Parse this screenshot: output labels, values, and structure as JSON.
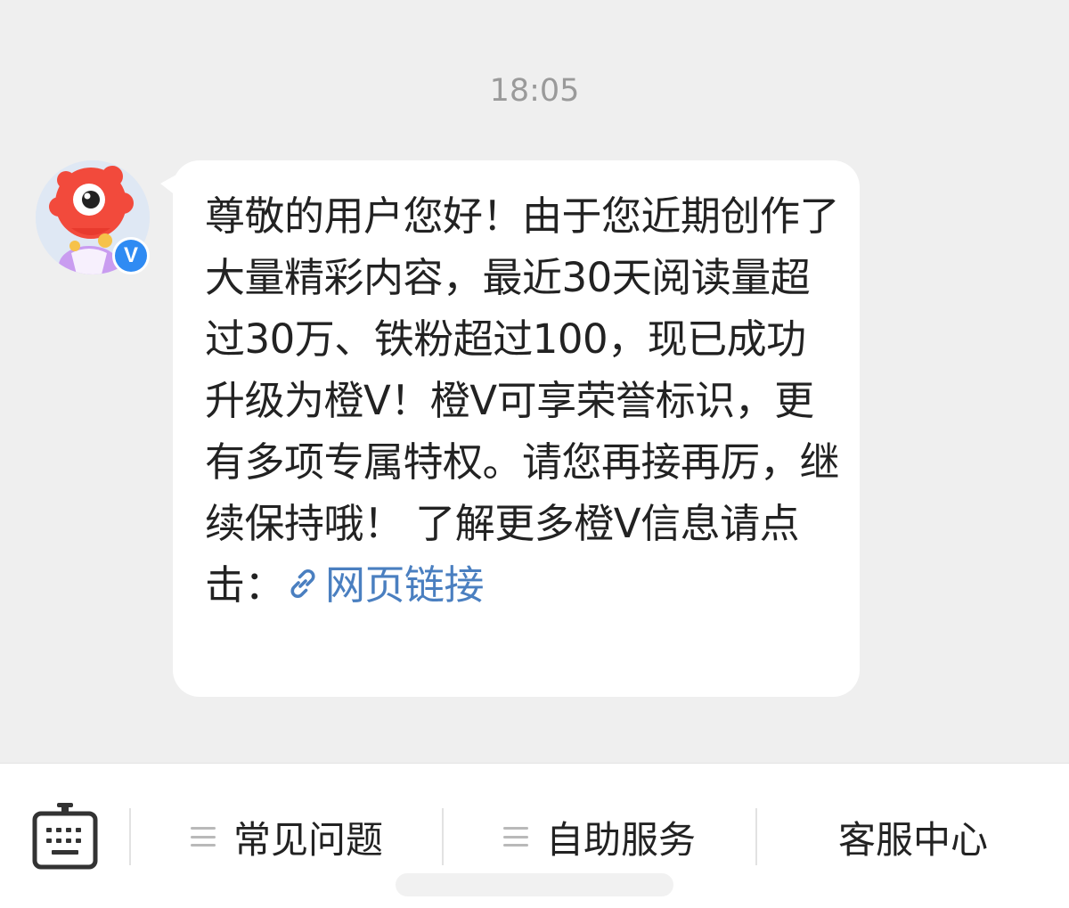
{
  "chat": {
    "timestamp": "18:05",
    "message": {
      "text": "尊敬的用户您好！由于您近期创作了大量精彩内容，最近30天阅读量超过30万、铁粉超过100，现已成功升级为橙V！橙V可享荣誉标识，更有多项专属特权。请您再接再厉，继续保持哦！ 了解更多橙V信息请点击：",
      "link_label": "网页链接"
    },
    "sender": {
      "avatar_icon": "weibo-mascot-avatar",
      "verified_badge": "V"
    }
  },
  "bottom_bar": {
    "keyboard_icon": "keyboard-icon",
    "menus": [
      {
        "label": "常见问题"
      },
      {
        "label": "自助服务"
      },
      {
        "label": "客服中心"
      }
    ]
  },
  "colors": {
    "background": "#efefef",
    "bubble": "#ffffff",
    "link": "#4a7fc0",
    "verified": "#2f8bf3"
  }
}
